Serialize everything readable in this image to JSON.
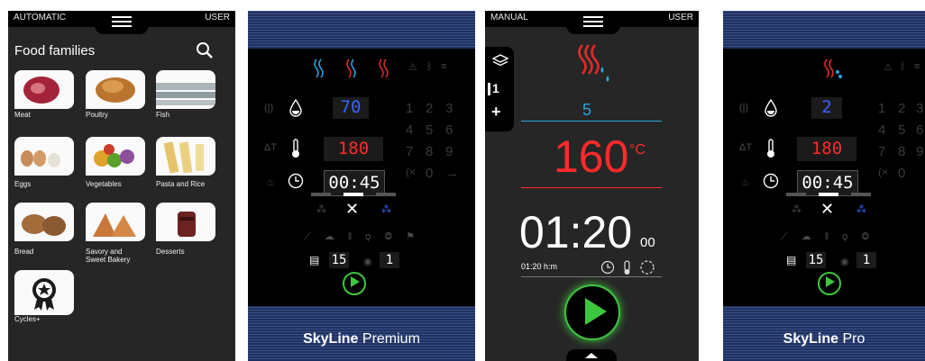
{
  "panel1": {
    "mode": "AUTOMATIC",
    "user": "USER",
    "title": "Food families",
    "families": [
      {
        "label": "Meat",
        "icon": "meat-photo"
      },
      {
        "label": "Poultry",
        "icon": "poultry-photo"
      },
      {
        "label": "Fish",
        "icon": "fish-photo"
      },
      {
        "label": "Eggs",
        "icon": "eggs-photo"
      },
      {
        "label": "Vegetables",
        "icon": "vegetables-photo"
      },
      {
        "label": "Pasta and Rice",
        "icon": "pasta-photo"
      },
      {
        "label": "Bread",
        "icon": "bread-photo"
      },
      {
        "label": "Savory and\nSweet Bakery",
        "icon": "bakery-photo"
      },
      {
        "label": "Desserts",
        "icon": "desserts-photo"
      },
      {
        "label": "Cycles+",
        "icon": "ribbon-star-icon"
      }
    ]
  },
  "panel2": {
    "humidity": "70",
    "temperature": "180",
    "time": "00:45",
    "cooking_steps": "15",
    "phase": "1",
    "keypad": [
      "1",
      "2",
      "3",
      "4",
      "5",
      "6",
      "7",
      "8",
      "9",
      "0"
    ],
    "brand_bold": "SkyLine",
    "brand_model": "Premium"
  },
  "panel3": {
    "mode": "MANUAL",
    "user": "USER",
    "phase": "1",
    "add": "+",
    "humidity_level": "5",
    "temperature": "160",
    "temp_unit": "°C",
    "time_main": "01:20",
    "time_sec": "00",
    "time_sub": "01:20 h:m"
  },
  "panel4": {
    "humidity": "2",
    "temperature": "180",
    "time": "00:45",
    "cooking_steps": "15",
    "phase": "1",
    "keypad": [
      "1",
      "2",
      "3",
      "4",
      "5",
      "6",
      "7",
      "8",
      "9",
      "0"
    ],
    "brand_bold": "SkyLine",
    "brand_model": "Pro"
  },
  "colors": {
    "accent_red": "#ff2a2a",
    "steam_blue": "#2aa6e0",
    "play_green": "#3ec63e",
    "brand_navy": "#1f3160"
  }
}
